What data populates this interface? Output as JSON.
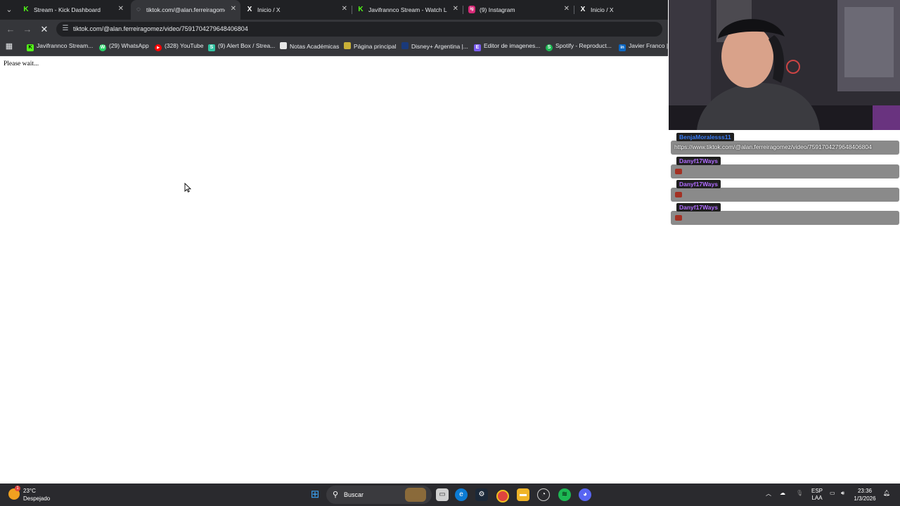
{
  "browser": {
    "tabs": [
      {
        "title": "Stream - Kick Dashboard",
        "favicon": "K",
        "active": false
      },
      {
        "title": "tiktok.com/@alan.ferreiragome",
        "favicon": "",
        "active": true
      },
      {
        "title": "Inicio / X",
        "favicon": "X",
        "active": false
      },
      {
        "title": "Javifrannco Stream - Watch Live",
        "favicon": "K",
        "active": false
      },
      {
        "title": "(9) Instagram",
        "favicon": "ig",
        "active": false
      },
      {
        "title": "Inicio / X",
        "favicon": "X",
        "active": false
      }
    ],
    "url": "tiktok.com/@alan.ferreiragomez/video/7591704279648406804",
    "bookmarks": [
      {
        "label": "Javifrannco Stream...",
        "color": "#53fc18",
        "glyph": "K"
      },
      {
        "label": "(29) WhatsApp",
        "color": "#25d366",
        "glyph": "W"
      },
      {
        "label": "(328) YouTube",
        "color": "#ff0000",
        "glyph": "▶"
      },
      {
        "label": "(9) Alert Box / Strea...",
        "color": "#31c3a2",
        "glyph": "S"
      },
      {
        "label": "Notas Académicas",
        "color": "#e8e8e8",
        "glyph": ""
      },
      {
        "label": "Página principal",
        "color": "#c9b037",
        "glyph": ""
      },
      {
        "label": "Disney+ Argentina |...",
        "color": "#1a3a7a",
        "glyph": ""
      },
      {
        "label": "Editor de imagenes...",
        "color": "#7a5cf0",
        "glyph": "E"
      },
      {
        "label": "Spotify - Reproduct...",
        "color": "#1db954",
        "glyph": "S"
      },
      {
        "label": "Javier Franco | Li",
        "color": "#0a66c2",
        "glyph": "in"
      }
    ]
  },
  "page": {
    "status_text": "Please wait..."
  },
  "chat": {
    "messages": [
      {
        "user": "BenjaMoralesss11",
        "text": "https://www.tiktok.com/@alan.ferreiragomez/video/7591704279648406804",
        "user_color": "#3a7cf5",
        "has_emote": false
      },
      {
        "user": "Danyf17Ways",
        "text": "",
        "user_color": "#b06cff",
        "has_emote": true
      },
      {
        "user": "Danyf17Ways",
        "text": "",
        "user_color": "#b06cff",
        "has_emote": true
      },
      {
        "user": "Danyf17Ways",
        "text": "",
        "user_color": "#b06cff",
        "has_emote": true
      }
    ]
  },
  "taskbar": {
    "weather": {
      "temp": "23°C",
      "condition": "Despejado",
      "badge": "1"
    },
    "search_placeholder": "Buscar",
    "language": {
      "line1": "ESP",
      "line2": "LAA"
    },
    "time": "23:36",
    "date": "1/3/2026"
  }
}
